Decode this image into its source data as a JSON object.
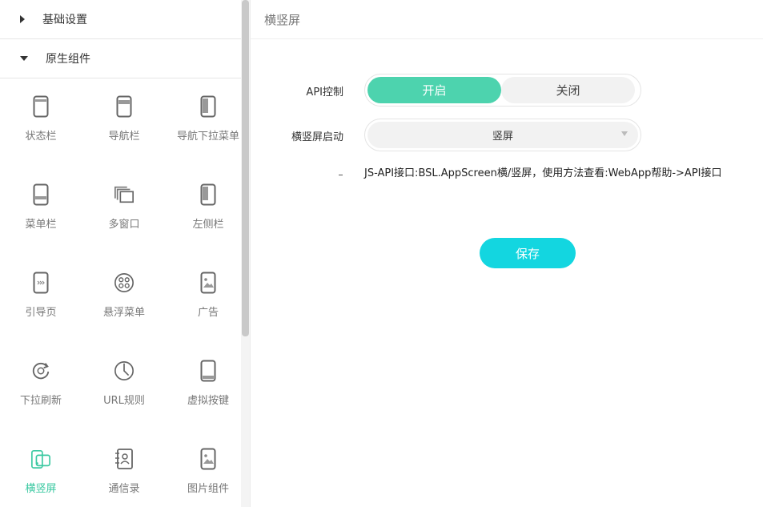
{
  "sidebar": {
    "sections": [
      {
        "label": "基础设置",
        "expanded": false
      },
      {
        "label": "原生组件",
        "expanded": true
      }
    ],
    "items": [
      {
        "label": "状态栏",
        "icon": "phone-status-bar-icon"
      },
      {
        "label": "导航栏",
        "icon": "phone-nav-bar-icon"
      },
      {
        "label": "导航下拉菜单",
        "icon": "phone-dropdown-icon"
      },
      {
        "label": "菜单栏",
        "icon": "phone-menu-bar-icon"
      },
      {
        "label": "多窗口",
        "icon": "multi-window-icon"
      },
      {
        "label": "左侧栏",
        "icon": "phone-left-sidebar-icon"
      },
      {
        "label": "引导页",
        "icon": "guide-page-icon"
      },
      {
        "label": "悬浮菜单",
        "icon": "floating-menu-icon"
      },
      {
        "label": "广告",
        "icon": "ad-image-icon"
      },
      {
        "label": "下拉刷新",
        "icon": "refresh-icon"
      },
      {
        "label": "URL规则",
        "icon": "clock-rule-icon"
      },
      {
        "label": "虚拟按键",
        "icon": "virtual-key-icon"
      },
      {
        "label": "横竖屏",
        "icon": "rotate-screen-icon",
        "active": true
      },
      {
        "label": "通信录",
        "icon": "contacts-icon"
      },
      {
        "label": "图片组件",
        "icon": "image-component-icon"
      }
    ],
    "active_color": "#3cc9a2"
  },
  "main": {
    "title": "横竖屏",
    "api_label": "API控制",
    "toggle": {
      "on_label": "开启",
      "off_label": "关闭",
      "selected": "开启"
    },
    "orientation_label": "横竖屏启动",
    "orientation_value": "竖屏",
    "hint": "JS-API接口:BSL.AppScreen横/竖屏，使用方法查看:WebApp帮助->API接口",
    "save_label": "保存"
  },
  "colors": {
    "toggle_on": "#4dd3ae",
    "save_button": "#13d6e0"
  }
}
